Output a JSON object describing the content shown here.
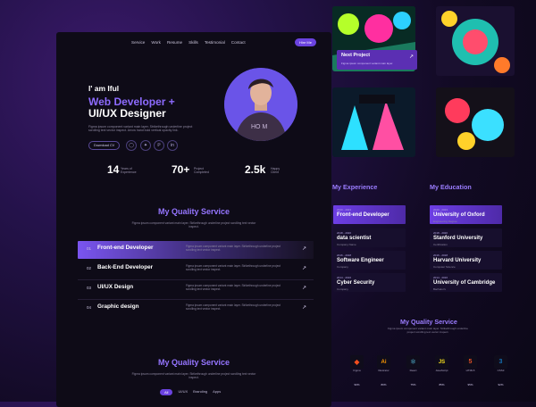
{
  "nav": {
    "items": [
      "Service",
      "Work",
      "Resume",
      "Skills",
      "Testimonial",
      "Contact"
    ],
    "hire_label": "Hire Me"
  },
  "hero": {
    "greeting": "I' am Iful",
    "title_accent": "Web Developer +",
    "title_main": "UI/UX Designer",
    "description": "Figma ipsum component variant main layer. Strikethrough underline project scrolling text vector inspect. Arrow hand bold vertical opacity link.",
    "download_label": "Download CV",
    "socials": [
      "github-icon",
      "twitter-icon",
      "pinterest-icon",
      "linkedin-icon"
    ]
  },
  "stats": [
    {
      "num": "14",
      "label_line1": "Years of",
      "label_line2": "Experience"
    },
    {
      "num": "70+",
      "label_line1": "Project",
      "label_line2": "Completed"
    },
    {
      "num": "2.5k",
      "label_line1": "Happy",
      "label_line2": "Client"
    }
  ],
  "service": {
    "title": "My Quality Service",
    "description": "Figma ipsum component variant main layer. Strikethrough underline project scrolling text vector inspect.",
    "rows": [
      {
        "num": "01",
        "name": "Front-end Developer",
        "text": "Figma ipsum component variant main layer. Strikethrough underline project scrolling text vector inspect."
      },
      {
        "num": "02",
        "name": "Back-End Developer",
        "text": "Figma ipsum component variant main layer. Strikethrough underline project scrolling text vector inspect."
      },
      {
        "num": "03",
        "name": "UI/UX Design",
        "text": "Figma ipsum component variant main layer. Strikethrough underline project scrolling text vector inspect."
      },
      {
        "num": "04",
        "name": "Graphic design",
        "text": "Figma ipsum component variant main layer. Strikethrough underline project scrolling text vector inspect."
      }
    ],
    "active_index": 0
  },
  "service2": {
    "title": "My Quality Service",
    "description": "Figma ipsum component variant main layer. Strikethrough underline project scrolling text vector inspect.",
    "tabs": [
      "All",
      "UI/UX",
      "Branding",
      "Apps"
    ],
    "active_tab": 0
  },
  "portfolio": {
    "next_title": "Next Project",
    "next_desc": "Figma ipsum component variant main layer."
  },
  "experience": {
    "title": "My Experience",
    "items": [
      {
        "date": "2020 - 2023",
        "title": "Front-end Developer",
        "place": "Company Name"
      },
      {
        "date": "2018 - 2020",
        "title": "data scientist",
        "place": "Company Name"
      },
      {
        "date": "2016 - 2018",
        "title": "Software Engineer",
        "place": "Company"
      },
      {
        "date": "2014 - 2016",
        "title": "Cyber Security",
        "place": "Company"
      }
    ]
  },
  "education": {
    "title": "My Education",
    "items": [
      {
        "date": "2020 - 2023",
        "title": "University of Oxford",
        "place": "Engineering Degree"
      },
      {
        "date": "2018 - 2020",
        "title": "Stanford University",
        "place": "Certification"
      },
      {
        "date": "2016 - 2018",
        "title": "Harvard University",
        "place": "Computer Science"
      },
      {
        "date": "2014 - 2016",
        "title": "University of Cambridge",
        "place": "Bachelor's"
      }
    ]
  },
  "skills": {
    "title": "My Quality Service",
    "description": "Figma ipsum component variant main layer. Strikethrough underline project scrolling text vector inspect.",
    "items": [
      {
        "icon": "figma-icon",
        "name": "Figma",
        "pct": "90%",
        "color": "#f24e1e"
      },
      {
        "icon": "illustrator-icon",
        "name": "Illustrator",
        "pct": "80%",
        "color": "#ff9a00"
      },
      {
        "icon": "react-icon",
        "name": "React",
        "pct": "75%",
        "color": "#61dafb"
      },
      {
        "icon": "javascript-icon",
        "name": "JavaScript",
        "pct": "85%",
        "color": "#f7df1e"
      },
      {
        "icon": "html5-icon",
        "name": "HTML5",
        "pct": "95%",
        "color": "#e34f26"
      },
      {
        "icon": "css3-icon",
        "name": "CSS3",
        "pct": "92%",
        "color": "#1572b6"
      }
    ]
  },
  "colors": {
    "accent": "#8d6bff",
    "accent_dark": "#6b43e0",
    "panel": "#0e0b17"
  }
}
